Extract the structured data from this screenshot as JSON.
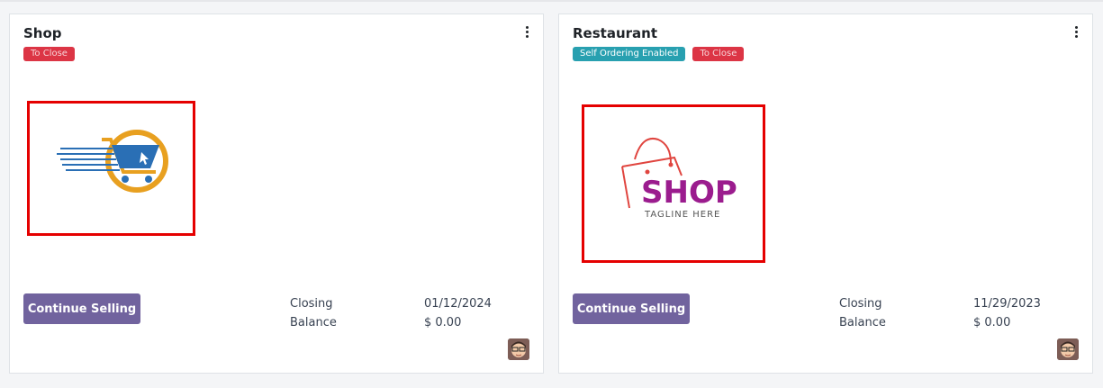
{
  "cards": [
    {
      "title": "Shop",
      "badges": [
        "To Close"
      ],
      "button_label": "Continue Selling",
      "closing_label": "Closing",
      "closing_value": "01/12/2024",
      "balance_label": "Balance",
      "balance_value": "$ 0.00",
      "image_icon": "fast-shopping-cart-logo"
    },
    {
      "title": "Restaurant",
      "badges": [
        "Self Ordering Enabled",
        "To Close"
      ],
      "button_label": "Continue Selling",
      "closing_label": "Closing",
      "closing_value": "11/29/2023",
      "balance_label": "Balance",
      "balance_value": "$ 0.00",
      "logo_text": "SHOP",
      "logo_tagline": "TAGLINE HERE",
      "image_icon": "shopping-bag-logo"
    }
  ],
  "colors": {
    "button": "#71639e",
    "badge_red": "#dc3545",
    "badge_teal": "#28a0b0",
    "highlight_box": "#e50000",
    "logo_purple": "#9b1c8e",
    "cart_blue": "#2a6fb5",
    "cart_orange": "#e8a020"
  }
}
